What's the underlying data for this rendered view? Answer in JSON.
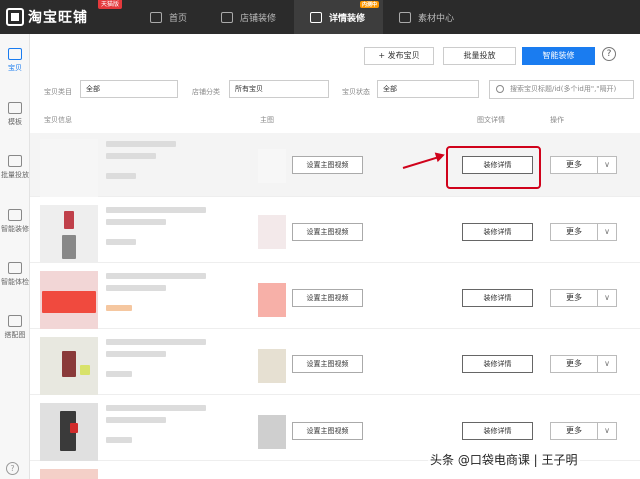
{
  "topbar": {
    "logo_text": "淘宝旺铺",
    "logo_badge": "天猫版",
    "nav": [
      {
        "label": "首页"
      },
      {
        "label": "店铺装修"
      },
      {
        "label": "详情装修",
        "active": true,
        "badge": "内测中"
      },
      {
        "label": "素材中心"
      }
    ]
  },
  "sidebar": {
    "items": [
      {
        "label": "宝贝",
        "active": true
      },
      {
        "label": "模板"
      },
      {
        "label": "批量投放"
      },
      {
        "label": "智能装修"
      },
      {
        "label": "智能体检"
      },
      {
        "label": "搭配图"
      }
    ],
    "help": "?"
  },
  "toolbar": {
    "publish_label": "+ 发布宝贝",
    "batch_label": "批量投放",
    "smart_label": "智能装修",
    "help": "?"
  },
  "filters": {
    "category_label": "宝贝类目",
    "category_value": "全部",
    "store_label": "店铺分类",
    "store_value": "所有宝贝",
    "status_label": "宝贝状态",
    "status_value": "全部",
    "search_placeholder": "搜索宝贝标题/id(多个id用\",\"隔开)"
  },
  "table": {
    "headers": [
      "宝贝信息",
      "主图",
      "图文详情",
      "操作"
    ],
    "video_label": "设置主图视频",
    "decor_label": "装修详情",
    "more_label": "更多",
    "caret": "∨"
  },
  "watermark": "头条 @口袋电商课 | 王子明",
  "colors": {
    "topbar": "#2b2b2b",
    "accent": "#1a7cf0",
    "annotation": "#d0021b"
  }
}
